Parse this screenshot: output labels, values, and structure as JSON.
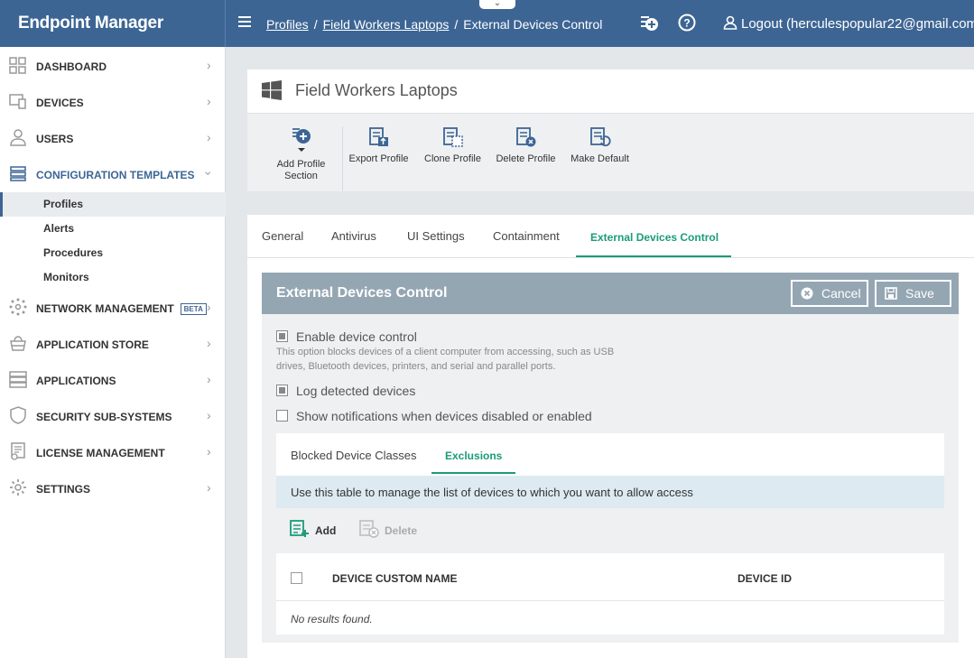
{
  "app": {
    "title": "Endpoint Manager"
  },
  "breadcrumb": {
    "items": [
      "Profiles",
      "Field Workers Laptops"
    ],
    "current": "External Devices Control"
  },
  "topbar": {
    "logout": "Logout (herculespopular22@gmail.com)"
  },
  "sidebar": {
    "items": [
      {
        "label": "DASHBOARD",
        "icon": "dashboard-icon"
      },
      {
        "label": "DEVICES",
        "icon": "devices-icon"
      },
      {
        "label": "USERS",
        "icon": "user-icon"
      },
      {
        "label": "CONFIGURATION TEMPLATES",
        "icon": "templates-icon"
      },
      {
        "label": "NETWORK MANAGEMENT",
        "icon": "network-icon",
        "badge": "BETA"
      },
      {
        "label": "APPLICATION STORE",
        "icon": "store-icon"
      },
      {
        "label": "APPLICATIONS",
        "icon": "applications-icon"
      },
      {
        "label": "SECURITY SUB-SYSTEMS",
        "icon": "shield-icon"
      },
      {
        "label": "LICENSE MANAGEMENT",
        "icon": "license-icon"
      },
      {
        "label": "SETTINGS",
        "icon": "gear-icon"
      }
    ],
    "subitems": [
      "Profiles",
      "Alerts",
      "Procedures",
      "Monitors"
    ]
  },
  "profile": {
    "title": "Field Workers Laptops",
    "toolbar": [
      "Add Profile Section",
      "Export Profile",
      "Clone Profile",
      "Delete Profile",
      "Make Default"
    ]
  },
  "tabs": [
    "General",
    "Antivirus",
    "UI Settings",
    "Containment",
    "External Devices Control"
  ],
  "panel": {
    "title": "External Devices Control",
    "cancel": "Cancel",
    "save": "Save",
    "enable_label": "Enable device control",
    "enable_hint": "This option blocks devices of a client computer from accessing, such as USB drives, Bluetooth devices, printers, and serial and parallel ports.",
    "log_label": "Log detected devices",
    "notify_label": "Show notifications when devices disabled or enabled",
    "inner_tabs": [
      "Blocked Device Classes",
      "Exclusions"
    ],
    "info": "Use this table to manage the list of devices to which you want to allow access",
    "add": "Add",
    "delete": "Delete",
    "columns": [
      "DEVICE CUSTOM NAME",
      "DEVICE ID"
    ],
    "empty": "No results found."
  },
  "colors": {
    "brand": "#3d6594",
    "accent": "#1b9c77",
    "panel_header": "#95a6b3"
  }
}
